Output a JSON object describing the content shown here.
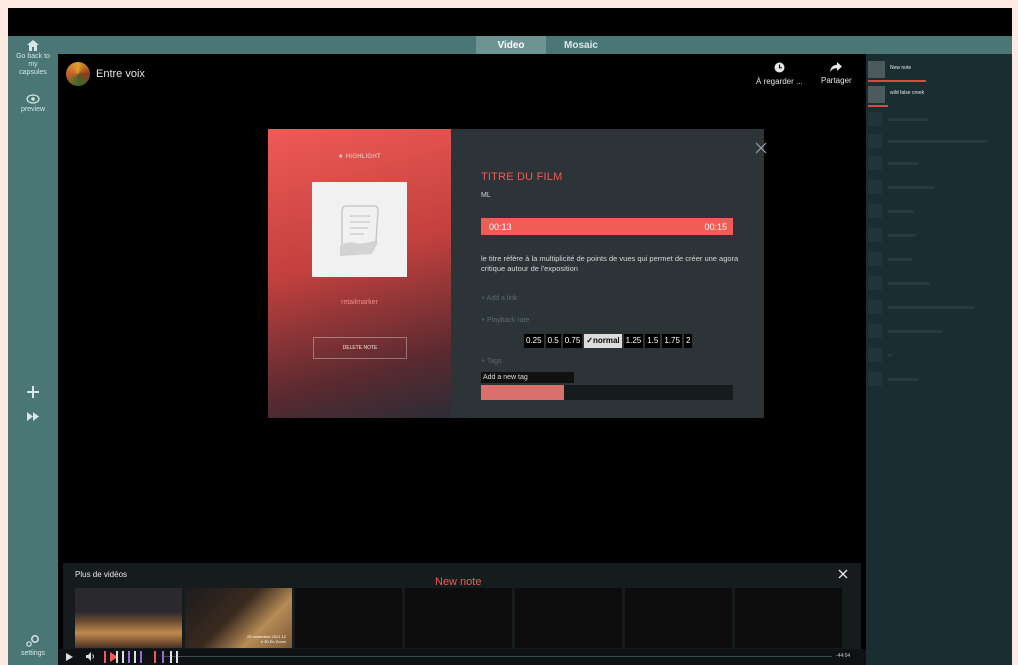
{
  "tabs": [
    "Video",
    "Mosaic"
  ],
  "sidebar": {
    "home_label": "Go back to my capsules",
    "preview_label": "preview",
    "settings_label": "settings"
  },
  "header": {
    "title": "Entre voix",
    "watch_later": "À regarder ...",
    "share": "Partager"
  },
  "notes": [
    {
      "label": "New note"
    },
    {
      "label": "wild false creek"
    }
  ],
  "modal": {
    "highlight": "★ HIGHLIGHT",
    "marker_name": "retailmarker",
    "delete_button": "DELETE NOTE",
    "title": "TITRE DU FILM",
    "subtitle": "ML",
    "time_start": "00:13",
    "time_end": "00:15",
    "text": "le titre réfère à la multiplicité de points de vues qui permet de créer une agora critique autour de l'exposition",
    "add_link": "+ Add a link",
    "playback_rate": "+ Playback rate",
    "rates": [
      "0.25",
      "0.5",
      "0.75",
      "✓normal",
      "1.25",
      "1.5",
      "1.75",
      "2"
    ],
    "selected_rate": "✓normal",
    "tags": "+ Tags",
    "tag_placeholder": "Add a new tag"
  },
  "more_videos": {
    "title": "Plus de vidéos",
    "new_note": "New note",
    "thumb2_date": "23 novembre 2021 12 h 30 En Zoom"
  },
  "player": {
    "total_time": "-44:04"
  },
  "colors": {
    "accent": "#ef5a55",
    "teal": "#4a7676"
  }
}
